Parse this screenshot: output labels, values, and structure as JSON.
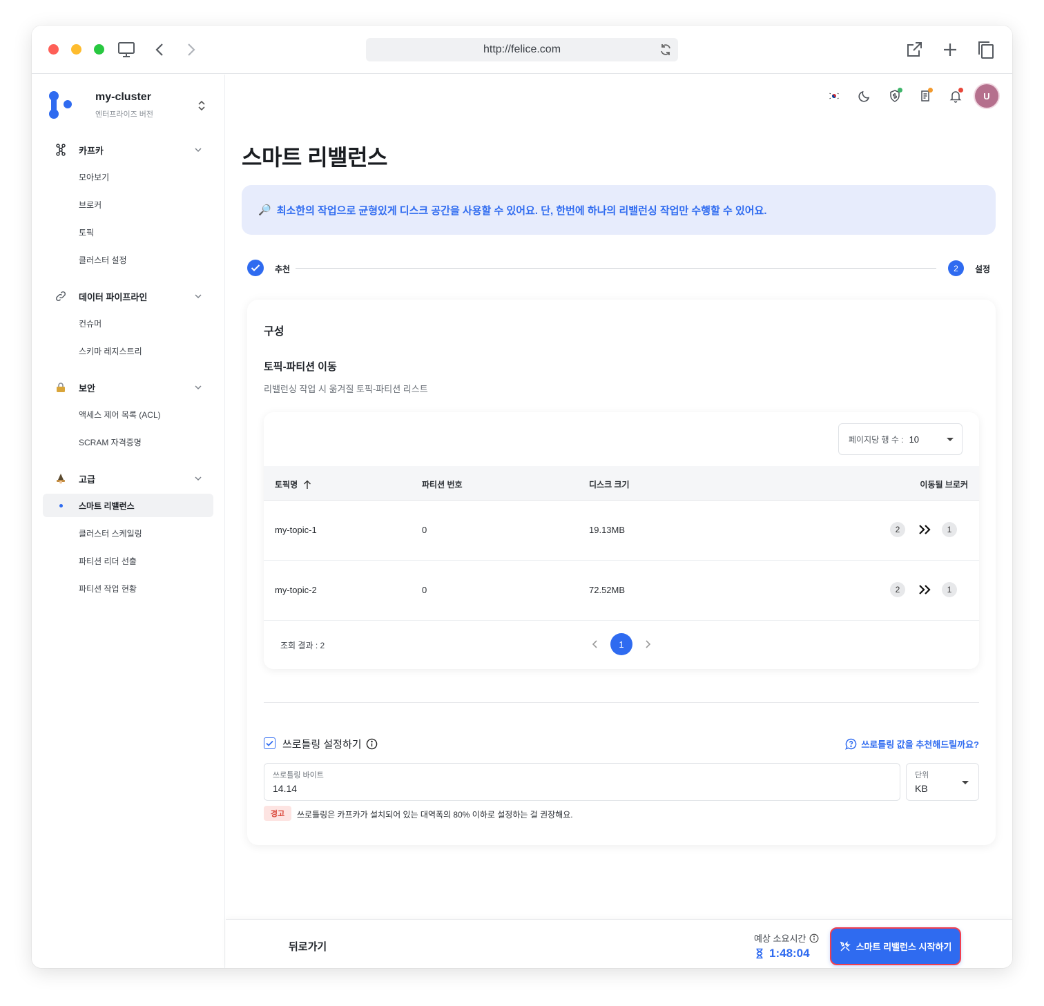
{
  "browser": {
    "url": "http://felice.com"
  },
  "sidebar": {
    "cluster_name": "my-cluster",
    "cluster_edition": "엔터프라이즈 버전",
    "groups": [
      {
        "label": "카프카",
        "icon": "kafka-icon",
        "items": [
          "모아보기",
          "브로커",
          "토픽",
          "클러스터 설정"
        ]
      },
      {
        "label": "데이터 파이프라인",
        "icon": "link-icon",
        "items": [
          "컨슈머",
          "스키마 레지스트리"
        ]
      },
      {
        "label": "보안",
        "icon": "lock-icon",
        "items": [
          "액세스 제어 목록 (ACL)",
          "SCRAM 자격증명"
        ]
      },
      {
        "label": "고급",
        "icon": "wizard-icon",
        "items": [
          "스마트 리밸런스",
          "클러스터 스케일링",
          "파티션 리더 선출",
          "파티션 작업 현황"
        ]
      }
    ],
    "active_item": "스마트 리밸런스"
  },
  "header": {
    "icons": [
      "korea-flag-icon",
      "moon-icon",
      "shield-dollar-icon",
      "document-icon",
      "bell-icon"
    ],
    "avatar_initial": "U",
    "badge_colors": {
      "shield": "#3fb56b",
      "document": "#f29a2e",
      "bell": "#e8473a"
    }
  },
  "page": {
    "title": "스마트 리밸런스",
    "banner_icon": "🔎",
    "banner_text": "최소한의 작업으로 균형있게 디스크 공간을 사용할 수 있어요. 단, 한번에 하나의 리밸런싱 작업만 수행할 수 있어요."
  },
  "stepper": {
    "step1_label": "추천",
    "step2_number": "2",
    "step2_label": "설정"
  },
  "config": {
    "title": "구성",
    "section_title": "토픽-파티션 이동",
    "section_desc": "리밸런싱 작업 시 옮겨질 토픽-파티션 리스트",
    "rows_per_page_label": "페이지당 행 수 :",
    "rows_per_page_value": "10",
    "columns": [
      "토픽명",
      "파티션 번호",
      "디스크 크기",
      "이동될 브로커"
    ],
    "rows": [
      {
        "topic": "my-topic-1",
        "partition": "0",
        "disk": "19.13MB",
        "from": "2",
        "to": "1"
      },
      {
        "topic": "my-topic-2",
        "partition": "0",
        "disk": "72.52MB",
        "from": "2",
        "to": "1"
      }
    ],
    "result_count": "조회 결과 : 2",
    "current_page": "1"
  },
  "throttling": {
    "checkbox_label": "쓰로틀링 설정하기",
    "checked": true,
    "recommend_link": "쓰로틀링 값을 추천해드릴까요?",
    "bytes_label": "쓰로틀링 바이트",
    "bytes_value": "14.14",
    "unit_label": "단위",
    "unit_value": "KB",
    "warning_badge": "경고",
    "warning_text": "쓰로틀링은 카프카가 설치되어 있는 대역폭의 80% 이하로 설정하는 걸 권장해요."
  },
  "footer": {
    "back_label": "뒤로가기",
    "eta_label": "예상 소요시간",
    "eta_value": "1:48:04",
    "start_label": "스마트 리밸런스 시작하기"
  },
  "colors": {
    "accent": "#2f6bf0",
    "banner_bg": "#e7ecfc",
    "warning": "#d9473a",
    "start_button_border": "#f1404f"
  }
}
